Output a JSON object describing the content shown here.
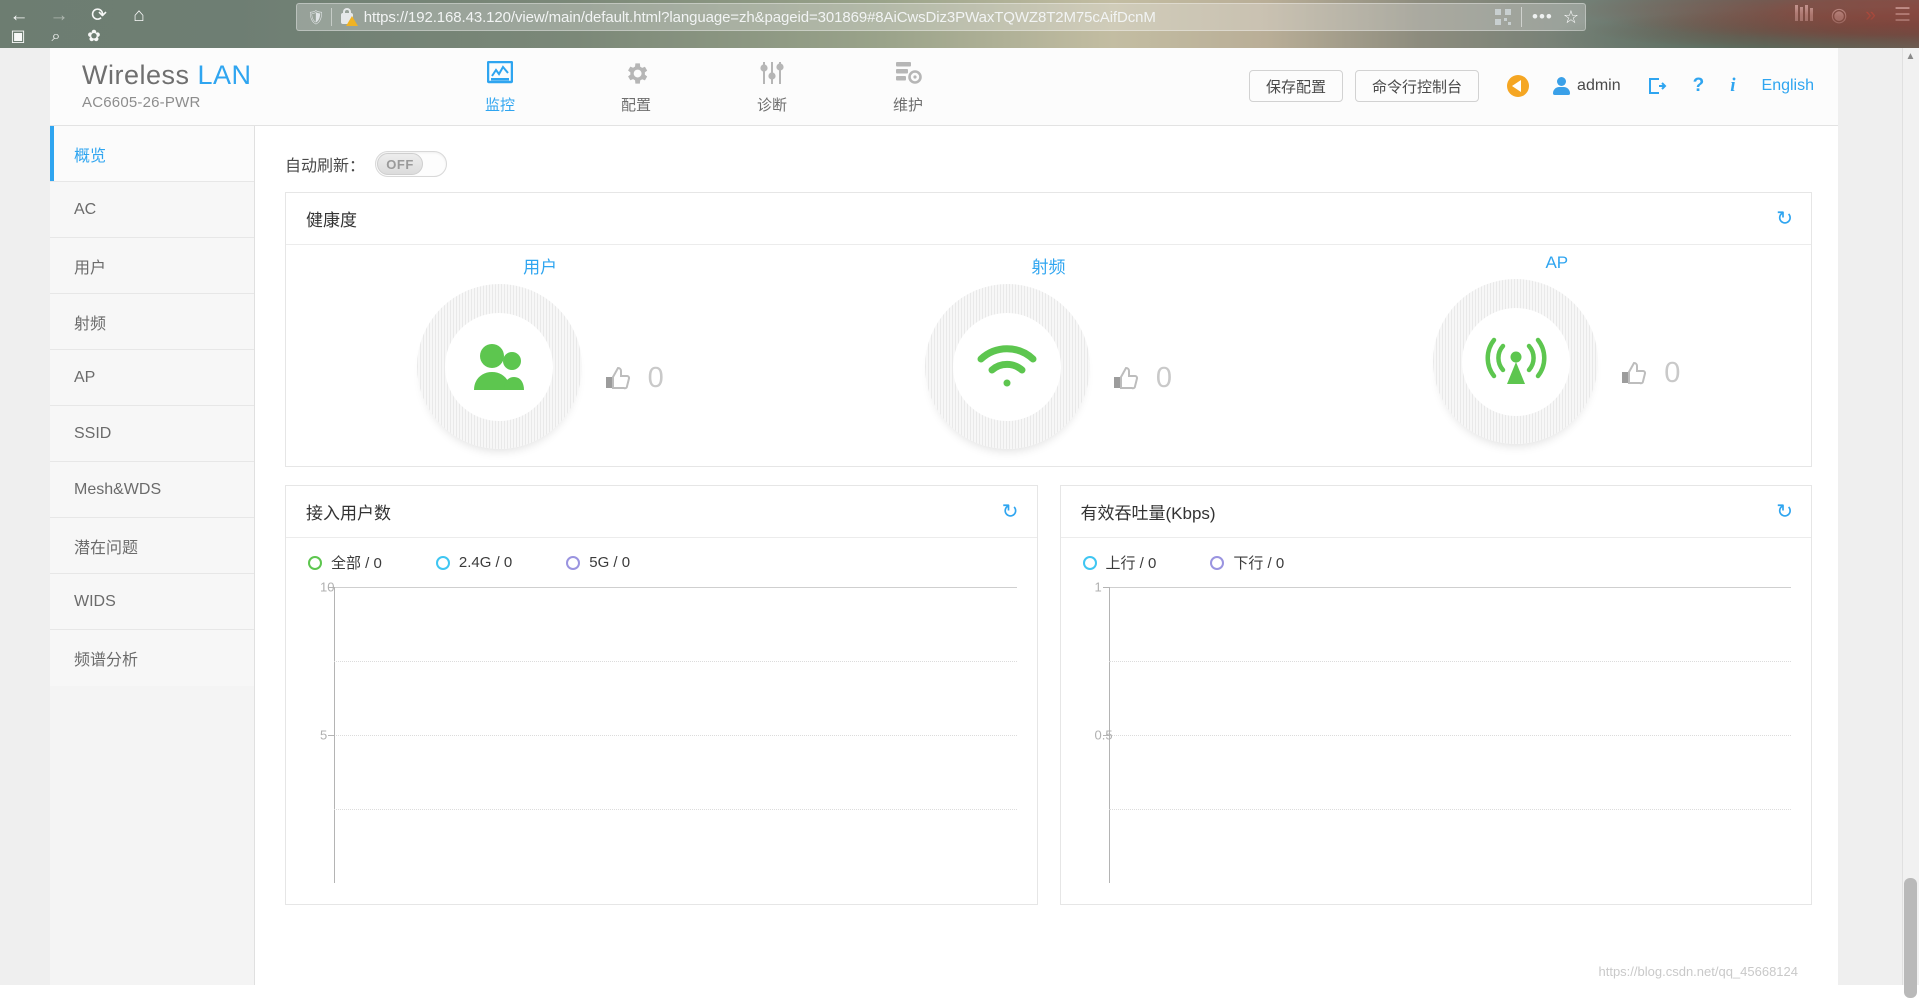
{
  "browser": {
    "url": "https://192.168.43.120/view/main/default.html?language=zh&pageid=301869#8AiCwsDiz3PWaxTQWZ8T2M75cAifDcnM",
    "back_icon": "←",
    "forward_icon": "→",
    "reload_icon": "⟳",
    "home_icon": "⌂",
    "bookmark_icon": "▣",
    "search_icon": "⌕",
    "settings_icon": "✿",
    "dots_icon": "•••",
    "star_icon": "☆",
    "library_icon": "library-icon",
    "account_icon": "◉",
    "pocket_icon": "»",
    "menu_icon": "☰"
  },
  "header": {
    "brand_primary": "Wireless",
    "brand_secondary": "LAN",
    "model": "AC6605-26-PWR",
    "nav": [
      {
        "label": "监控",
        "icon": "monitor-icon",
        "active": true
      },
      {
        "label": "配置",
        "icon": "gear-icon",
        "active": false
      },
      {
        "label": "诊断",
        "icon": "sliders-icon",
        "active": false
      },
      {
        "label": "维护",
        "icon": "maintenance-icon",
        "active": false
      }
    ],
    "save_config_label": "保存配置",
    "cli_console_label": "命令行控制台",
    "alarm_icon": "alarm-icon",
    "user_name": "admin",
    "logout_icon": "⇥",
    "help_icon": "?",
    "info_icon": "i",
    "language_label": "English"
  },
  "sidebar": {
    "items": [
      {
        "label": "概览",
        "active": true
      },
      {
        "label": "AC",
        "active": false
      },
      {
        "label": "用户",
        "active": false
      },
      {
        "label": "射频",
        "active": false
      },
      {
        "label": "AP",
        "active": false
      },
      {
        "label": "SSID",
        "active": false
      },
      {
        "label": "Mesh&WDS",
        "active": false
      },
      {
        "label": "潜在问题",
        "active": false
      },
      {
        "label": "WIDS",
        "active": false
      },
      {
        "label": "频谱分析",
        "active": false
      }
    ]
  },
  "content": {
    "auto_refresh_label": "自动刷新：",
    "auto_refresh_state": "OFF",
    "health": {
      "title": "健康度",
      "refresh_icon": "↻",
      "columns": [
        {
          "label": "用户",
          "icon": "users-icon",
          "score": "0",
          "thumb_icon": "thumbs-up-icon"
        },
        {
          "label": "射频",
          "icon": "wifi-icon",
          "score": "0",
          "thumb_icon": "thumbs-up-icon"
        },
        {
          "label": "AP",
          "icon": "ap-antenna-icon",
          "score": "0",
          "thumb_icon": "thumbs-up-icon"
        }
      ]
    },
    "users_chart_title": "接入用户数",
    "throughput_chart_title": "有效吞吐量(Kbps)",
    "refresh_icon": "↻"
  },
  "chart_data": [
    {
      "type": "line",
      "title": "接入用户数",
      "series": [
        {
          "name": "全部 / 0",
          "color": "#5dc64f",
          "values": []
        },
        {
          "name": "2.4G / 0",
          "color": "#3fc6f2",
          "values": []
        },
        {
          "name": "5G / 0",
          "color": "#9a94e0",
          "values": []
        }
      ],
      "x": [],
      "xlabel": "",
      "ylabel": "",
      "ylim": [
        0,
        10
      ],
      "yticks": [
        10,
        5
      ],
      "gridlines": [
        10,
        7.5,
        5,
        2.5
      ],
      "grid": true,
      "legend_position": "top-left"
    },
    {
      "type": "line",
      "title": "有效吞吐量(Kbps)",
      "series": [
        {
          "name": "上行 / 0",
          "color": "#3fc6f2",
          "values": []
        },
        {
          "name": "下行 / 0",
          "color": "#9a94e0",
          "values": []
        }
      ],
      "x": [],
      "xlabel": "",
      "ylabel": "",
      "ylim": [
        0,
        1
      ],
      "yticks": [
        1,
        0.5
      ],
      "gridlines": [
        1,
        0.75,
        0.5,
        0.25
      ],
      "grid": true,
      "legend_position": "top-left"
    }
  ],
  "watermark": "https://blog.csdn.net/qq_45668124",
  "colors": {
    "accent": "#2fa5f0",
    "green": "#5dc64f",
    "cyan": "#3fc6f2",
    "purple": "#9a94e0",
    "orange": "#f5a623"
  }
}
